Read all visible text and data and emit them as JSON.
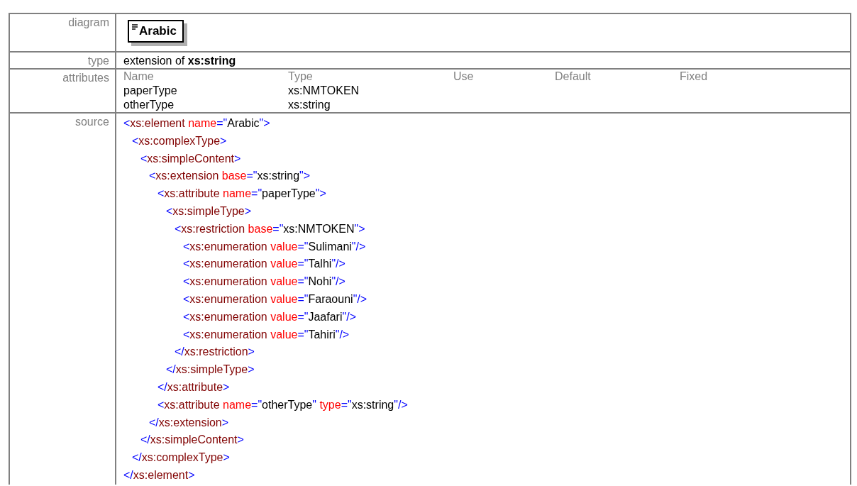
{
  "rows": [
    {
      "kind": "diagram",
      "label": "diagram",
      "element": "Arabic"
    },
    {
      "kind": "type",
      "label": "type",
      "text": "extension of **xs:string**"
    },
    {
      "kind": "attributes",
      "label": "attributes",
      "columns": [
        "Name",
        "Type",
        "Use",
        "Default",
        "Fixed"
      ],
      "items": [
        [
          "paperType",
          "xs:NMTOKEN"
        ],
        [
          "otherType",
          "xs:string"
        ]
      ]
    },
    {
      "kind": "source",
      "label": "source",
      "code": [
        {
          "open": [
            {
              "kind": "punct",
              "text": "<"
            },
            {
              "kind": "tag",
              "text": "xs:element"
            },
            {
              "kind": "attr",
              "text": " name"
            },
            {
              "kind": "punct",
              "text": "=\""
            },
            {
              "kind": "value",
              "text": "Arabic"
            },
            {
              "kind": "punct",
              "text": "\">"
            }
          ],
          "children": [
            {
              "open": [
                {
                  "kind": "punct",
                  "text": "<"
                },
                {
                  "kind": "tag",
                  "text": "xs:complexType"
                },
                {
                  "kind": "punct",
                  "text": ">"
                }
              ],
              "children": [
                {
                  "open": [
                    {
                      "kind": "punct",
                      "text": "<"
                    },
                    {
                      "kind": "tag",
                      "text": "xs:simpleContent"
                    },
                    {
                      "kind": "punct",
                      "text": ">"
                    }
                  ],
                  "children": [
                    {
                      "open": [
                        {
                          "kind": "punct",
                          "text": "<"
                        },
                        {
                          "kind": "tag",
                          "text": "xs:extension"
                        },
                        {
                          "kind": "attr",
                          "text": " base"
                        },
                        {
                          "kind": "punct",
                          "text": "=\""
                        },
                        {
                          "kind": "value",
                          "text": "xs:string"
                        },
                        {
                          "kind": "punct",
                          "text": "\">"
                        }
                      ],
                      "children": [
                        {
                          "open": [
                            {
                              "kind": "punct",
                              "text": "<"
                            },
                            {
                              "kind": "tag",
                              "text": "xs:attribute"
                            },
                            {
                              "kind": "attr",
                              "text": " name"
                            },
                            {
                              "kind": "punct",
                              "text": "=\""
                            },
                            {
                              "kind": "value",
                              "text": "paperType"
                            },
                            {
                              "kind": "punct",
                              "text": "\">"
                            }
                          ],
                          "children": [
                            {
                              "open": [
                                {
                                  "kind": "punct",
                                  "text": "<"
                                },
                                {
                                  "kind": "tag",
                                  "text": "xs:simpleType"
                                },
                                {
                                  "kind": "punct",
                                  "text": ">"
                                }
                              ],
                              "children": [
                                {
                                  "open": [
                                    {
                                      "kind": "punct",
                                      "text": "<"
                                    },
                                    {
                                      "kind": "tag",
                                      "text": "xs:restriction"
                                    },
                                    {
                                      "kind": "attr",
                                      "text": " base"
                                    },
                                    {
                                      "kind": "punct",
                                      "text": "=\""
                                    },
                                    {
                                      "kind": "value",
                                      "text": "xs:NMTOKEN"
                                    },
                                    {
                                      "kind": "punct",
                                      "text": "\">"
                                    }
                                  ],
                                  "children": [
                                    {
                                      "open": [
                                        {
                                          "kind": "punct",
                                          "text": "<"
                                        },
                                        {
                                          "kind": "tag",
                                          "text": "xs:enumeration"
                                        },
                                        {
                                          "kind": "attr",
                                          "text": " value"
                                        },
                                        {
                                          "kind": "punct",
                                          "text": "=\""
                                        },
                                        {
                                          "kind": "value",
                                          "text": "Sulimani"
                                        },
                                        {
                                          "kind": "punct",
                                          "text": "\"/>"
                                        }
                                      ]
                                    },
                                    {
                                      "open": [
                                        {
                                          "kind": "punct",
                                          "text": "<"
                                        },
                                        {
                                          "kind": "tag",
                                          "text": "xs:enumeration"
                                        },
                                        {
                                          "kind": "attr",
                                          "text": " value"
                                        },
                                        {
                                          "kind": "punct",
                                          "text": "=\""
                                        },
                                        {
                                          "kind": "value",
                                          "text": "Talhi"
                                        },
                                        {
                                          "kind": "punct",
                                          "text": "\"/>"
                                        }
                                      ]
                                    },
                                    {
                                      "open": [
                                        {
                                          "kind": "punct",
                                          "text": "<"
                                        },
                                        {
                                          "kind": "tag",
                                          "text": "xs:enumeration"
                                        },
                                        {
                                          "kind": "attr",
                                          "text": " value"
                                        },
                                        {
                                          "kind": "punct",
                                          "text": "=\""
                                        },
                                        {
                                          "kind": "value",
                                          "text": "Nohi"
                                        },
                                        {
                                          "kind": "punct",
                                          "text": "\"/>"
                                        }
                                      ]
                                    },
                                    {
                                      "open": [
                                        {
                                          "kind": "punct",
                                          "text": "<"
                                        },
                                        {
                                          "kind": "tag",
                                          "text": "xs:enumeration"
                                        },
                                        {
                                          "kind": "attr",
                                          "text": " value"
                                        },
                                        {
                                          "kind": "punct",
                                          "text": "=\""
                                        },
                                        {
                                          "kind": "value",
                                          "text": "Faraouni"
                                        },
                                        {
                                          "kind": "punct",
                                          "text": "\"/>"
                                        }
                                      ]
                                    },
                                    {
                                      "open": [
                                        {
                                          "kind": "punct",
                                          "text": "<"
                                        },
                                        {
                                          "kind": "tag",
                                          "text": "xs:enumeration"
                                        },
                                        {
                                          "kind": "attr",
                                          "text": " value"
                                        },
                                        {
                                          "kind": "punct",
                                          "text": "=\""
                                        },
                                        {
                                          "kind": "value",
                                          "text": "Jaafari"
                                        },
                                        {
                                          "kind": "punct",
                                          "text": "\"/>"
                                        }
                                      ]
                                    },
                                    {
                                      "open": [
                                        {
                                          "kind": "punct",
                                          "text": "<"
                                        },
                                        {
                                          "kind": "tag",
                                          "text": "xs:enumeration"
                                        },
                                        {
                                          "kind": "attr",
                                          "text": " value"
                                        },
                                        {
                                          "kind": "punct",
                                          "text": "=\""
                                        },
                                        {
                                          "kind": "value",
                                          "text": "Tahiri"
                                        },
                                        {
                                          "kind": "punct",
                                          "text": "\"/>"
                                        }
                                      ]
                                    }
                                  ],
                                  "close": [
                                    {
                                      "kind": "punct",
                                      "text": "</"
                                    },
                                    {
                                      "kind": "tag",
                                      "text": "xs:restriction"
                                    },
                                    {
                                      "kind": "punct",
                                      "text": ">"
                                    }
                                  ]
                                }
                              ],
                              "close": [
                                {
                                  "kind": "punct",
                                  "text": "</"
                                },
                                {
                                  "kind": "tag",
                                  "text": "xs:simpleType"
                                },
                                {
                                  "kind": "punct",
                                  "text": ">"
                                }
                              ]
                            }
                          ],
                          "close": [
                            {
                              "kind": "punct",
                              "text": "</"
                            },
                            {
                              "kind": "tag",
                              "text": "xs:attribute"
                            },
                            {
                              "kind": "punct",
                              "text": ">"
                            }
                          ]
                        },
                        {
                          "open": [
                            {
                              "kind": "punct",
                              "text": "<"
                            },
                            {
                              "kind": "tag",
                              "text": "xs:attribute"
                            },
                            {
                              "kind": "attr",
                              "text": " name"
                            },
                            {
                              "kind": "punct",
                              "text": "=\""
                            },
                            {
                              "kind": "value",
                              "text": "otherType"
                            },
                            {
                              "kind": "punct",
                              "text": "\""
                            },
                            {
                              "kind": "attr",
                              "text": " type"
                            },
                            {
                              "kind": "punct",
                              "text": "=\""
                            },
                            {
                              "kind": "value",
                              "text": "xs:string"
                            },
                            {
                              "kind": "punct",
                              "text": "\"/>"
                            }
                          ]
                        }
                      ],
                      "close": [
                        {
                          "kind": "punct",
                          "text": "</"
                        },
                        {
                          "kind": "tag",
                          "text": "xs:extension"
                        },
                        {
                          "kind": "punct",
                          "text": ">"
                        }
                      ]
                    }
                  ],
                  "close": [
                    {
                      "kind": "punct",
                      "text": "</"
                    },
                    {
                      "kind": "tag",
                      "text": "xs:simpleContent"
                    },
                    {
                      "kind": "punct",
                      "text": ">"
                    }
                  ]
                }
              ],
              "close": [
                {
                  "kind": "punct",
                  "text": "</"
                },
                {
                  "kind": "tag",
                  "text": "xs:complexType"
                },
                {
                  "kind": "punct",
                  "text": ">"
                }
              ]
            }
          ],
          "close": [
            {
              "kind": "punct",
              "text": "</"
            },
            {
              "kind": "tag",
              "text": "xs:element"
            },
            {
              "kind": "punct",
              "text": ">"
            }
          ]
        }
      ]
    }
  ]
}
